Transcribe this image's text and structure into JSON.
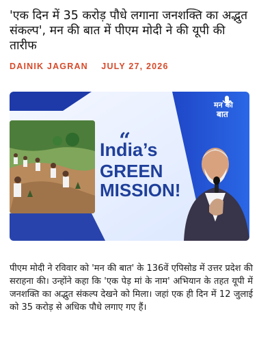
{
  "article": {
    "headline": "'एक दिन में 35 करोड़ पौधे लगाना जनशक्ति का अद्भुत संकल्प', मन की बात में पीएम मोदी ने की यूपी की तारीफ",
    "source": "DAINIK JAGRAN",
    "date": "JULY 27, 2026",
    "body": "पीएम मोदी ने रविवार को 'मन की बात' के 136वें एपिसोड में उत्तर प्रदेश की सराहना की। उन्होंने कहा कि 'एक पेड़ मां के नाम' अभियान के तहत यूपी में जनशक्ति का अद्भुत संकल्प देखने को मिला। जहां एक ही दिन में 12 जुलाई को 35 करोड़ से अधिक पौधे लगाए गए हैं।"
  },
  "hero": {
    "quote_mark": "“",
    "title_line1": "India’s",
    "title_line2": "GREEN",
    "title_line3": "MISSION!",
    "logo_line1": "मन की",
    "logo_line2": "बात",
    "mic_icon": "microphone-icon",
    "accent_color": "#1f3f9a",
    "logo_bg": "#2f5bd6"
  }
}
